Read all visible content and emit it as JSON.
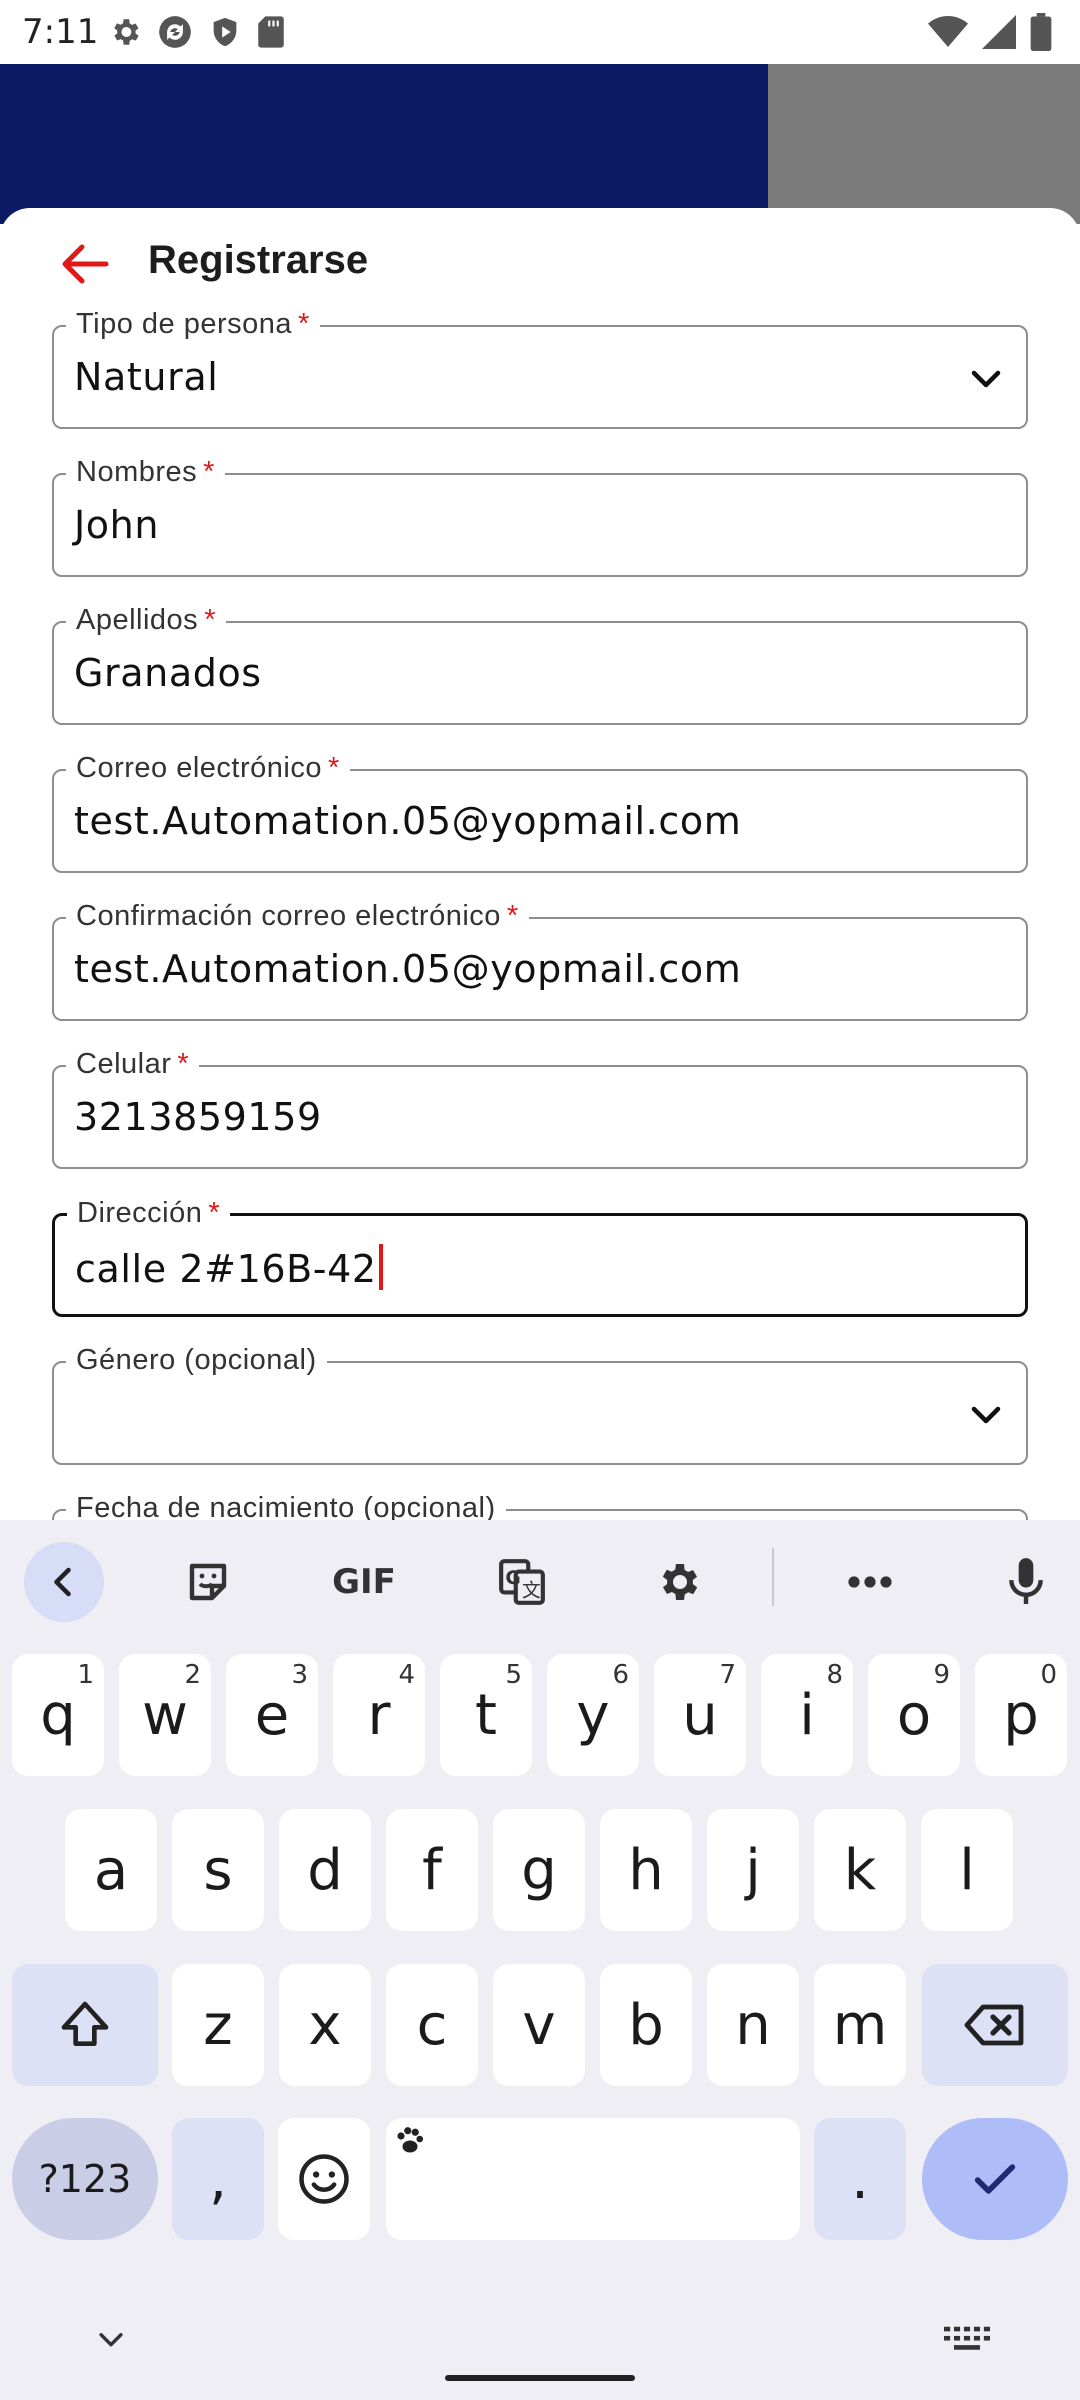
{
  "status_bar": {
    "time": "7:11",
    "left_icons": [
      "gear-icon",
      "sync-icon",
      "shield-icon",
      "sd-card-icon"
    ],
    "right_icons": [
      "wifi-icon",
      "signal-icon",
      "battery-icon"
    ]
  },
  "form": {
    "title": "Registrarse",
    "required_mark": "*",
    "fields": [
      {
        "label": "Tipo de persona",
        "value": "Natural",
        "required": true,
        "type": "select"
      },
      {
        "label": "Nombres",
        "value": "John",
        "required": true,
        "type": "text"
      },
      {
        "label": "Apellidos",
        "value": "Granados",
        "required": true,
        "type": "text"
      },
      {
        "label": "Correo electrónico",
        "value": "test.Automation.05@yopmail.com",
        "required": true,
        "type": "text"
      },
      {
        "label": "Confirmación correo electrónico",
        "value": "test.Automation.05@yopmail.com",
        "required": true,
        "type": "text"
      },
      {
        "label": "Celular",
        "value": "3213859159",
        "required": true,
        "type": "text"
      },
      {
        "label": "Dirección",
        "value": "calle 2#16B-42",
        "required": true,
        "type": "text",
        "focused": true
      },
      {
        "label": "Género (opcional)",
        "value": "",
        "required": false,
        "type": "select"
      },
      {
        "label": "Fecha de nacimiento (opcional)",
        "value": "",
        "required": false,
        "type": "text"
      }
    ]
  },
  "keyboard": {
    "toolbar": [
      "back-icon",
      "sticker-icon",
      "GIF",
      "translate-icon",
      "settings-icon",
      "more-icon",
      "microphone-icon"
    ],
    "gif_label": "GIF",
    "row1": [
      {
        "k": "q",
        "h": "1"
      },
      {
        "k": "w",
        "h": "2"
      },
      {
        "k": "e",
        "h": "3"
      },
      {
        "k": "r",
        "h": "4"
      },
      {
        "k": "t",
        "h": "5"
      },
      {
        "k": "y",
        "h": "6"
      },
      {
        "k": "u",
        "h": "7"
      },
      {
        "k": "i",
        "h": "8"
      },
      {
        "k": "o",
        "h": "9"
      },
      {
        "k": "p",
        "h": "0"
      }
    ],
    "row2": [
      "a",
      "s",
      "d",
      "f",
      "g",
      "h",
      "j",
      "k",
      "l"
    ],
    "row3": [
      "z",
      "x",
      "c",
      "v",
      "b",
      "n",
      "m"
    ],
    "symbols_label": "?123",
    "comma": ",",
    "period": "."
  },
  "colors": {
    "header_navy": "#0c1a66",
    "header_gray": "#7a7a7a",
    "accent_red": "#e01818",
    "keyboard_bg": "#f0eef5",
    "key_mod": "#dde1f6",
    "key_enter": "#aebdf8"
  }
}
